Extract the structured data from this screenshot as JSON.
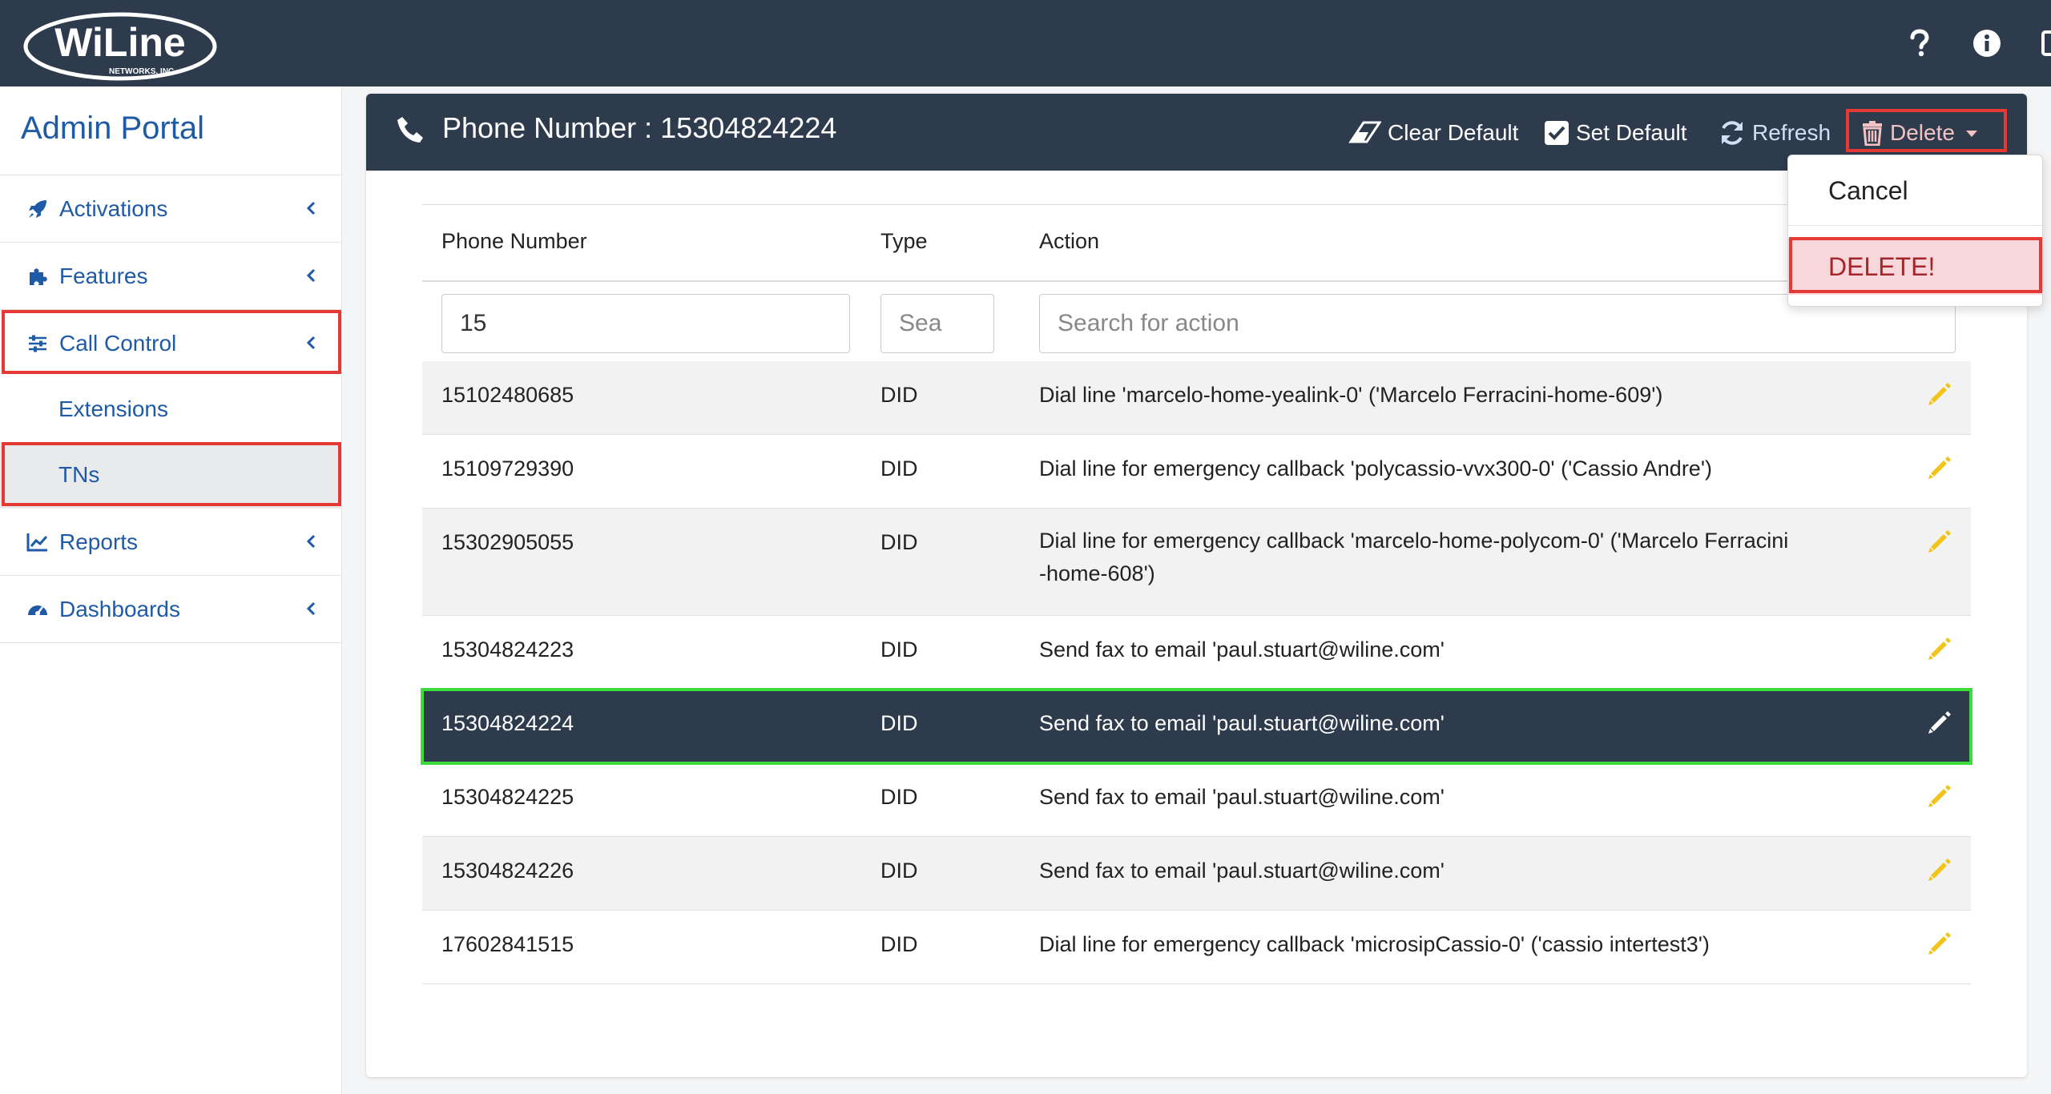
{
  "brand": {
    "logo_text": "WiLine",
    "logo_sub": "NETWORKS, INC."
  },
  "topbar": {
    "icons": [
      "help-icon",
      "info-icon",
      "logout-icon"
    ]
  },
  "sidebar": {
    "title": "Admin Portal",
    "items": [
      {
        "label": "Activations",
        "icon": "rocket-icon"
      },
      {
        "label": "Features",
        "icon": "puzzle-icon"
      },
      {
        "label": "Call Control",
        "icon": "sliders-icon"
      },
      {
        "label": "Extensions"
      },
      {
        "label": "TNs"
      },
      {
        "label": "Reports",
        "icon": "chart-line-icon"
      },
      {
        "label": "Dashboards",
        "icon": "gauge-icon"
      }
    ]
  },
  "header": {
    "title": "Phone Number : 15304824224",
    "clear_default": "Clear Default",
    "set_default": "Set Default",
    "refresh": "Refresh",
    "delete": "Delete"
  },
  "dropdown": {
    "cancel": "Cancel",
    "delete": "DELETE!"
  },
  "table": {
    "columns": [
      "Phone Number",
      "Type",
      "Action"
    ],
    "filters": {
      "phone_value": "15",
      "type_placeholder": "Sea",
      "action_placeholder": "Search for action"
    },
    "rows": [
      {
        "number": "15102480685",
        "type": "DID",
        "action": "Dial line 'marcelo-home-yealink-0' ('Marcelo Ferracini-home-609')"
      },
      {
        "number": "15109729390",
        "type": "DID",
        "action": "Dial line for emergency callback 'polycassio-vvx300-0' ('Cassio Andre')"
      },
      {
        "number": "15302905055",
        "type": "DID",
        "action_line1": "Dial line for emergency callback 'marcelo-home-polycom-0' ('Marcelo Ferracini",
        "action_line2": "-home-608')"
      },
      {
        "number": "15304824223",
        "type": "DID",
        "action": "Send fax to email 'paul.stuart@wiline.com'"
      },
      {
        "number": "15304824224",
        "type": "DID",
        "action": "Send fax to email 'paul.stuart@wiline.com'"
      },
      {
        "number": "15304824225",
        "type": "DID",
        "action": "Send fax to email 'paul.stuart@wiline.com'"
      },
      {
        "number": "15304824226",
        "type": "DID",
        "action": "Send fax to email 'paul.stuart@wiline.com'"
      },
      {
        "number": "17602841515",
        "type": "DID",
        "action": "Dial line for emergency callback 'microsipCassio-0' ('cassio intertest3')"
      }
    ]
  },
  "colors": {
    "navbar": "#2e3b4d",
    "link": "#1f5aa6",
    "highlight": "#e53935",
    "selected_outline": "#3ddc3d",
    "pencil": "#f0c419"
  }
}
